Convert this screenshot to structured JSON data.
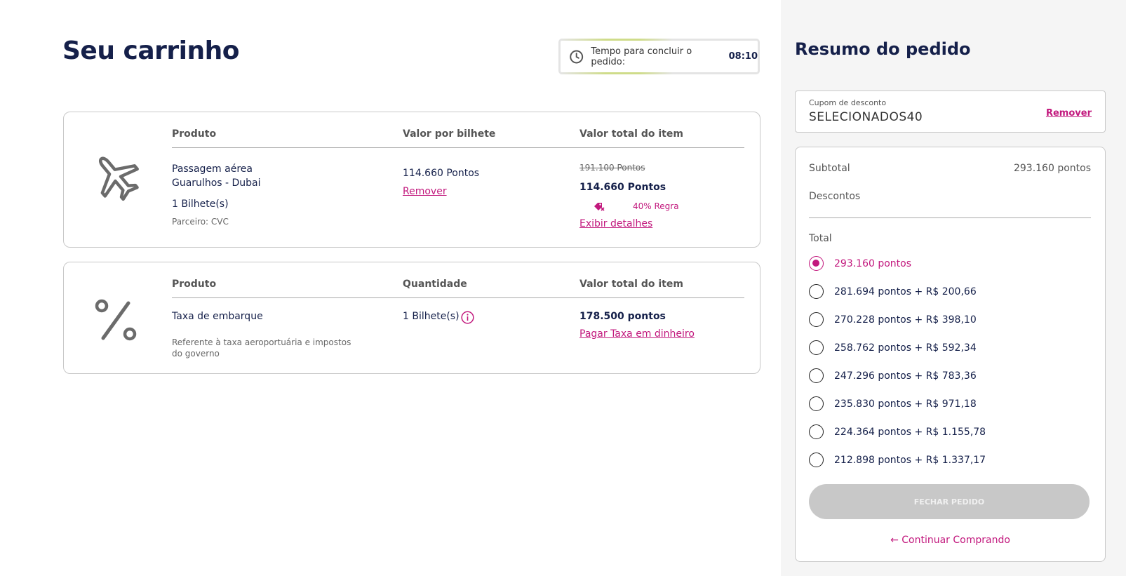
{
  "cart": {
    "title": "Seu carrinho",
    "timer": {
      "label": "Tempo para concluir o pedido:",
      "time": "08:10"
    },
    "items": [
      {
        "icon": "airplane-icon",
        "headers": [
          "Produto",
          "Valor por bilhete",
          "Valor total do item"
        ],
        "product_name": "Passagem aérea",
        "route": "Guarulhos - Dubai",
        "tickets": "1 Bilhete(s)",
        "partner": "Parceiro: CVC",
        "unit_value": "114.660 Pontos",
        "remove_label": "Remover",
        "original_total": "191.100 Pontos",
        "total": "114.660 Pontos",
        "rule_label": "40% Regra",
        "details_label": "Exibir detalhes"
      },
      {
        "icon": "percent-icon",
        "headers": [
          "Produto",
          "Quantidade",
          "Valor total do item"
        ],
        "product_name": "Taxa de embarque",
        "description": "Referente à taxa aeroportuária e impostos do governo",
        "quantity": "1 Bilhete(s)",
        "total": "178.500 pontos",
        "pay_cash_label": "Pagar Taxa em dinheiro"
      }
    ]
  },
  "summary": {
    "title": "Resumo do pedido",
    "coupon": {
      "label": "Cupom de desconto",
      "code": "SELECIONADOS40",
      "remove_label": "Remover"
    },
    "subtotal_label": "Subtotal",
    "subtotal_value": "293.160 pontos",
    "discounts_label": "Descontos",
    "total_label": "Total",
    "payment_options": [
      {
        "label": "293.160 pontos",
        "selected": true
      },
      {
        "label": "281.694 pontos + R$ 200,66",
        "selected": false
      },
      {
        "label": "270.228 pontos + R$ 398,10",
        "selected": false
      },
      {
        "label": "258.762 pontos + R$ 592,34",
        "selected": false
      },
      {
        "label": "247.296 pontos + R$ 783,36",
        "selected": false
      },
      {
        "label": "235.830 pontos + R$ 971,18",
        "selected": false
      },
      {
        "label": "224.364 pontos + R$ 1.155,78",
        "selected": false
      },
      {
        "label": "212.898 pontos + R$ 1.337,17",
        "selected": false
      }
    ],
    "close_button": "FECHAR PEDIDO",
    "continue_label": "← Continuar Comprando"
  },
  "colors": {
    "accent": "#c2187d",
    "navy": "#15204a",
    "disabled": "#c8c8c8"
  }
}
